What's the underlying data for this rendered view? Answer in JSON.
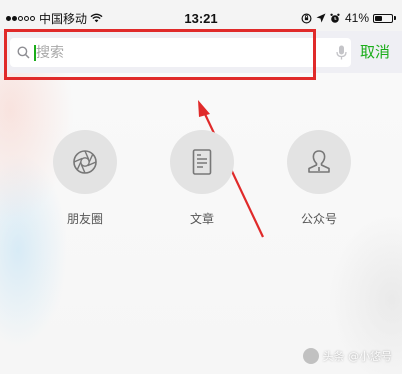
{
  "status_bar": {
    "carrier": "中国移动",
    "time": "13:21",
    "battery_percent": "41%",
    "battery_level": 0.41,
    "signal_bars_full": 2,
    "signal_bars_total": 5,
    "icons": [
      "signal-dots-icon",
      "wifi-icon",
      "rotation-lock-icon",
      "location-arrow-icon",
      "alarm-icon",
      "battery-icon"
    ]
  },
  "search": {
    "placeholder": "搜索",
    "value": "",
    "cancel_label": "取消",
    "icons": [
      "search-icon",
      "microphone-icon"
    ]
  },
  "shortcuts": [
    {
      "label": "朋友圈",
      "icon": "moments-shutter-icon"
    },
    {
      "label": "文章",
      "icon": "article-document-icon"
    },
    {
      "label": "公众号",
      "icon": "official-account-person-icon"
    }
  ],
  "watermark": {
    "text": "头条 @小悠号"
  },
  "colors": {
    "accent_green": "#1aad19",
    "annotation_red": "#e02a2a",
    "header_bg": "#efeff4"
  }
}
